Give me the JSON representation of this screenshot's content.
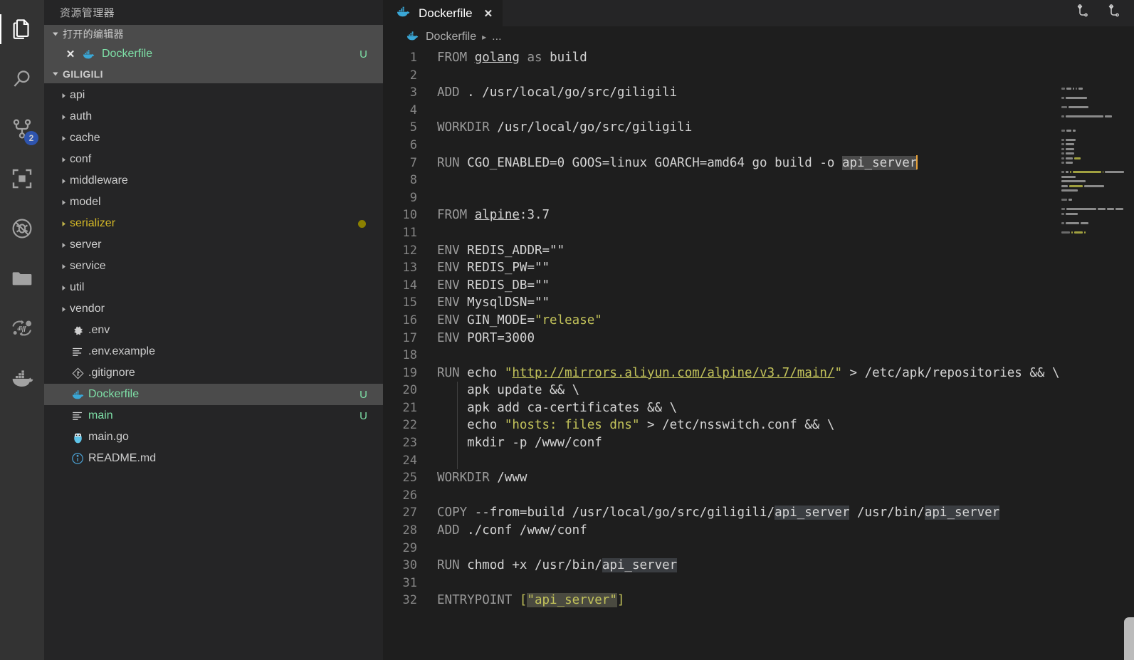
{
  "activitybar": {
    "items": [
      {
        "name": "explorer",
        "icon": "files-icon",
        "active": true,
        "badge": null
      },
      {
        "name": "search",
        "icon": "search-icon",
        "active": false,
        "badge": null
      },
      {
        "name": "source-control",
        "icon": "source-control-icon",
        "active": false,
        "badge": "2"
      },
      {
        "name": "extensions",
        "icon": "extensions-icon",
        "active": false,
        "badge": null
      },
      {
        "name": "debug-disabled",
        "icon": "no-debug-icon",
        "active": false,
        "badge": null
      },
      {
        "name": "folder",
        "icon": "folder-icon",
        "active": false,
        "badge": null
      },
      {
        "name": "diff",
        "icon": "diff-icon",
        "active": false,
        "badge": null
      },
      {
        "name": "docker",
        "icon": "docker-whale-icon",
        "active": false,
        "badge": null
      }
    ]
  },
  "sidebar": {
    "title": "资源管理器",
    "open_editors": {
      "label": "打开的编辑器",
      "items": [
        {
          "name": "Dockerfile",
          "flag": "U",
          "icon": "docker-whale-icon",
          "color": "#7ee0a7"
        }
      ]
    },
    "project": {
      "label": "GILIGILI",
      "folders": [
        {
          "name": "api"
        },
        {
          "name": "auth"
        },
        {
          "name": "cache"
        },
        {
          "name": "conf"
        },
        {
          "name": "middleware"
        },
        {
          "name": "model"
        },
        {
          "name": "serializer",
          "modified": true,
          "color": "#d4b826"
        },
        {
          "name": "server"
        },
        {
          "name": "service"
        },
        {
          "name": "util"
        },
        {
          "name": "vendor"
        }
      ],
      "files": [
        {
          "name": ".env",
          "icon": "gear-icon",
          "color": "#cccccc",
          "flag": null
        },
        {
          "name": ".env.example",
          "icon": "lines-icon",
          "color": "#cccccc",
          "flag": null
        },
        {
          "name": ".gitignore",
          "icon": "git-icon",
          "color": "#cccccc",
          "flag": null
        },
        {
          "name": "Dockerfile",
          "icon": "docker-whale-icon",
          "color": "#7ee0a7",
          "flag": "U",
          "selected": true
        },
        {
          "name": "main",
          "icon": "lines-icon",
          "color": "#7ee0a7",
          "flag": "U"
        },
        {
          "name": "main.go",
          "icon": "go-gopher-icon",
          "color": "#cccccc",
          "flag": null
        },
        {
          "name": "README.md",
          "icon": "info-icon",
          "color": "#cccccc",
          "flag": null
        }
      ]
    }
  },
  "editor": {
    "tab": {
      "label": "Dockerfile",
      "icon": "docker-whale-icon",
      "close": "✕",
      "dirty": false
    },
    "tab_actions": [
      {
        "name": "split-editor-right-icon"
      },
      {
        "name": "split-editor-down-icon"
      }
    ],
    "breadcrumbs": {
      "file": "Dockerfile",
      "separator": "▸",
      "more": "..."
    },
    "selection_term": "api_server",
    "cursor_line": 7,
    "lines": [
      {
        "n": 1,
        "tokens": [
          {
            "t": "FROM ",
            "c": "kw"
          },
          {
            "t": "golang",
            "c": "txt underl"
          },
          {
            "t": " ",
            "c": "txt"
          },
          {
            "t": "as",
            "c": "kw"
          },
          {
            "t": " build",
            "c": "txt"
          }
        ]
      },
      {
        "n": 2,
        "tokens": []
      },
      {
        "n": 3,
        "tokens": [
          {
            "t": "ADD ",
            "c": "kw"
          },
          {
            "t": ". /usr/local/go/src/giligili",
            "c": "txt"
          }
        ]
      },
      {
        "n": 4,
        "tokens": []
      },
      {
        "n": 5,
        "tokens": [
          {
            "t": "WORKDIR ",
            "c": "kw"
          },
          {
            "t": "/usr/local/go/src/giligili",
            "c": "txt"
          }
        ]
      },
      {
        "n": 6,
        "tokens": []
      },
      {
        "n": 7,
        "tokens": [
          {
            "t": "RUN ",
            "c": "kw"
          },
          {
            "t": "CGO_ENABLED=0 GOOS=linux GOARCH=amd64 go build -o ",
            "c": "txt"
          },
          {
            "t": "api_server",
            "c": "sel"
          },
          {
            "t": "",
            "c": "caret"
          }
        ]
      },
      {
        "n": 8,
        "tokens": []
      },
      {
        "n": 9,
        "tokens": []
      },
      {
        "n": 10,
        "tokens": [
          {
            "t": "FROM ",
            "c": "kw"
          },
          {
            "t": "alpine",
            "c": "txt underl"
          },
          {
            "t": ":3.7",
            "c": "txt"
          }
        ]
      },
      {
        "n": 11,
        "tokens": []
      },
      {
        "n": 12,
        "tokens": [
          {
            "t": "ENV ",
            "c": "kw"
          },
          {
            "t": "REDIS_ADDR=\"\"",
            "c": "txt"
          }
        ]
      },
      {
        "n": 13,
        "tokens": [
          {
            "t": "ENV ",
            "c": "kw"
          },
          {
            "t": "REDIS_PW=\"\"",
            "c": "txt"
          }
        ]
      },
      {
        "n": 14,
        "tokens": [
          {
            "t": "ENV ",
            "c": "kw"
          },
          {
            "t": "REDIS_DB=\"\"",
            "c": "txt"
          }
        ]
      },
      {
        "n": 15,
        "tokens": [
          {
            "t": "ENV ",
            "c": "kw"
          },
          {
            "t": "MysqlDSN=\"\"",
            "c": "txt"
          }
        ]
      },
      {
        "n": 16,
        "tokens": [
          {
            "t": "ENV ",
            "c": "kw"
          },
          {
            "t": "GIN_MODE=",
            "c": "txt"
          },
          {
            "t": "\"release\"",
            "c": "str"
          }
        ]
      },
      {
        "n": 17,
        "tokens": [
          {
            "t": "ENV ",
            "c": "kw"
          },
          {
            "t": "PORT=3000",
            "c": "txt"
          }
        ]
      },
      {
        "n": 18,
        "tokens": []
      },
      {
        "n": 19,
        "tokens": [
          {
            "t": "RUN ",
            "c": "kw"
          },
          {
            "t": "echo ",
            "c": "txt"
          },
          {
            "t": "\"",
            "c": "str"
          },
          {
            "t": "http://mirrors.aliyun.com/alpine/v3.7/main/",
            "c": "url"
          },
          {
            "t": "\"",
            "c": "str"
          },
          {
            "t": " > /etc/apk/repositories && \\",
            "c": "txt"
          }
        ]
      },
      {
        "n": 20,
        "tokens": [
          {
            "t": "    apk update && \\",
            "c": "txt"
          }
        ],
        "indent": true
      },
      {
        "n": 21,
        "tokens": [
          {
            "t": "    apk add ca-certificates && \\",
            "c": "txt"
          }
        ],
        "indent": true
      },
      {
        "n": 22,
        "tokens": [
          {
            "t": "    echo ",
            "c": "txt"
          },
          {
            "t": "\"hosts: files dns\"",
            "c": "str"
          },
          {
            "t": " > /etc/nsswitch.conf && \\",
            "c": "txt"
          }
        ],
        "indent": true
      },
      {
        "n": 23,
        "tokens": [
          {
            "t": "    mkdir -p /www/conf",
            "c": "txt"
          }
        ],
        "indent": true
      },
      {
        "n": 24,
        "tokens": [],
        "indent": true
      },
      {
        "n": 25,
        "tokens": [
          {
            "t": "WORKDIR ",
            "c": "kw"
          },
          {
            "t": "/www",
            "c": "txt"
          }
        ]
      },
      {
        "n": 26,
        "tokens": []
      },
      {
        "n": 27,
        "tokens": [
          {
            "t": "COPY ",
            "c": "kw"
          },
          {
            "t": "--from=build /usr/local/go/src/giligili/",
            "c": "txt"
          },
          {
            "t": "api_server",
            "c": "selw"
          },
          {
            "t": " /usr/bin/",
            "c": "txt"
          },
          {
            "t": "api_server",
            "c": "selw"
          }
        ]
      },
      {
        "n": 28,
        "tokens": [
          {
            "t": "ADD ",
            "c": "kw"
          },
          {
            "t": "./conf /www/conf",
            "c": "txt"
          }
        ]
      },
      {
        "n": 29,
        "tokens": []
      },
      {
        "n": 30,
        "tokens": [
          {
            "t": "RUN ",
            "c": "kw"
          },
          {
            "t": "chmod +x /usr/bin/",
            "c": "txt"
          },
          {
            "t": "api_server",
            "c": "selw"
          }
        ]
      },
      {
        "n": 31,
        "tokens": []
      },
      {
        "n": 32,
        "tokens": [
          {
            "t": "ENTRYPOINT ",
            "c": "kw"
          },
          {
            "t": "[",
            "c": "str"
          },
          {
            "t": "\"api_server\"",
            "c": "selw-str"
          },
          {
            "t": "]",
            "c": "str"
          }
        ]
      }
    ]
  },
  "colors": {
    "activitybar_bg": "#333333",
    "sidebar_bg": "#252526",
    "editor_bg": "#1e1e1e",
    "selection_bg": "#4a4a4a",
    "word_highlight_bg": "#3a3d41",
    "caret": "#e8a33d",
    "accent_badge": "#2d5fd7",
    "string": "#c3c35a",
    "keyword": "#9a9a9a",
    "text": "#d4d4d4",
    "git_untracked": "#7ee0a7",
    "git_modified": "#d4b826"
  }
}
